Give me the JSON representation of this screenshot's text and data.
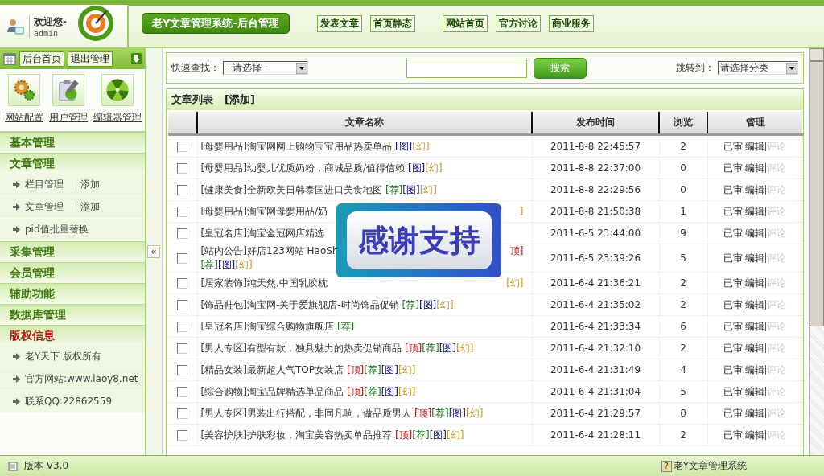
{
  "header": {
    "welcome": "欢迎您-",
    "user": "admin",
    "title": "老Y文章管理系统-后台管理",
    "nav_groups": [
      [
        "发表文章",
        "首页静态"
      ],
      [
        "网站首页",
        "官方讨论",
        "商业服务"
      ]
    ]
  },
  "sidebar": {
    "top_buttons": [
      "后台首页",
      "退出管理"
    ],
    "shortcuts": [
      {
        "label": "网站配置",
        "kind": "gears"
      },
      {
        "label": "用户管理",
        "kind": "clipboard"
      },
      {
        "label": "编辑器管理",
        "kind": "ball"
      }
    ],
    "sections": [
      {
        "title": "基本管理",
        "color": "#3d7a12"
      },
      {
        "title": "文章管理",
        "color": "#3d7a12",
        "items": [
          {
            "label": "栏目管理",
            "link": "添加"
          },
          {
            "label": "文章管理",
            "link": "添加"
          },
          {
            "label": "pid值批量替换"
          }
        ]
      },
      {
        "title": "采集管理",
        "color": "#3d7a12"
      },
      {
        "title": "会员管理",
        "color": "#3d7a12"
      },
      {
        "title": "辅助功能",
        "color": "#3d7a12"
      },
      {
        "title": "数据库管理",
        "color": "#3d7a12"
      },
      {
        "title": "版权信息",
        "color": "#b0200c",
        "items": [
          {
            "label": "老Y天下 版权所有"
          },
          {
            "label": "官方网站:www.laoy8.net"
          },
          {
            "label": "联系QQ:22862559"
          }
        ]
      }
    ],
    "collapse": "«"
  },
  "toolbar": {
    "search_label": "快速查找：",
    "search_select": "--请选择--",
    "search_button": "搜索",
    "jump_label": "跳转到：",
    "jump_select": "请选择分类"
  },
  "list": {
    "title": "文章列表",
    "add_link": "[添加]",
    "columns": [
      "文章名称",
      "发布时间",
      "浏览",
      "管理"
    ],
    "rows": [
      {
        "checked": false,
        "category": "[母婴用品]",
        "title": "淘宝网网上购物宝宝用品热卖单品",
        "tags": [
          {
            "text": "[图]",
            "color": "#10108a"
          },
          {
            "text": "[幻]",
            "color": "#c89a2a"
          }
        ],
        "time": "2011-8-8 22:45:57",
        "views": "2"
      },
      {
        "checked": false,
        "category": "[母婴用品]",
        "title": "幼婴儿优质奶粉，商城品质/值得信赖",
        "tags": [
          {
            "text": "[图]",
            "color": "#10108a"
          },
          {
            "text": "[幻]",
            "color": "#c89a2a"
          }
        ],
        "time": "2011-8-8 22:37:00",
        "views": "0"
      },
      {
        "checked": false,
        "category": "[健康美食]",
        "title": "全新欧美日韩泰国进口美食地图",
        "tags": [
          {
            "text": "[荐]",
            "color": "#1a7a1a"
          },
          {
            "text": "[图]",
            "color": "#10108a"
          },
          {
            "text": "[幻]",
            "color": "#c89a2a"
          }
        ],
        "time": "2011-8-8 22:29:56",
        "views": "0"
      },
      {
        "checked": false,
        "category": "[母婴用品]",
        "title": "淘宝网母婴用品/奶",
        "covered": true,
        "tags": [
          {
            "text": "]",
            "color": "#c89a2a"
          }
        ],
        "time": "2011-8-8 21:50:38",
        "views": "1"
      },
      {
        "checked": false,
        "category": "[皇冠名店]",
        "title": "淘宝金冠网店精选",
        "time": "2011-6-5 23:44:00",
        "views": "9"
      },
      {
        "checked": false,
        "category": "[站内公告]",
        "title": "好店123网站 HaoSh",
        "covered": true,
        "tags": [
          {
            "text": "顶]",
            "color": "#c01818"
          }
        ],
        "tags_line2": [
          {
            "text": "[荐]",
            "color": "#1a7a1a"
          },
          {
            "text": "[图]",
            "color": "#10108a"
          },
          {
            "text": "[幻]",
            "color": "#c89a2a"
          }
        ],
        "time": "2011-6-5 23:39:26",
        "views": "5"
      },
      {
        "checked": false,
        "category": "[居家装饰]",
        "title": "纯天然,中国乳胶枕",
        "covered": true,
        "tags": [
          {
            "text": "[幻]",
            "color": "#c89a2a"
          }
        ],
        "time": "2011-6-4 21:36:21",
        "views": "2"
      },
      {
        "checked": false,
        "category": "[饰品鞋包]",
        "title": "淘宝网-关于爱旗舰店-时尚饰品促销",
        "tags": [
          {
            "text": "[荐]",
            "color": "#1a7a1a"
          },
          {
            "text": "[图]",
            "color": "#10108a"
          },
          {
            "text": "[幻]",
            "color": "#c89a2a"
          }
        ],
        "time": "2011-6-4 21:35:02",
        "views": "2"
      },
      {
        "checked": false,
        "category": "[皇冠名店]",
        "title": "淘宝综合购物旗舰店",
        "tags": [
          {
            "text": "[荐]",
            "color": "#1a7a1a"
          }
        ],
        "time": "2011-6-4 21:33:34",
        "views": "6"
      },
      {
        "checked": false,
        "category": "[男人专区]",
        "title": "有型有款，独具魅力的热卖促销商品",
        "tags": [
          {
            "text": "[顶]",
            "color": "#c01818"
          },
          {
            "text": "[荐]",
            "color": "#1a7a1a"
          },
          {
            "text": "[图]",
            "color": "#10108a"
          },
          {
            "text": "[幻]",
            "color": "#c89a2a"
          }
        ],
        "time": "2011-6-4 21:32:10",
        "views": "2"
      },
      {
        "checked": false,
        "category": "[精品女装]",
        "title": "最新超人气TOP女装店",
        "tags": [
          {
            "text": "[顶]",
            "color": "#c01818"
          },
          {
            "text": "[荐]",
            "color": "#1a7a1a"
          },
          {
            "text": "[图]",
            "color": "#10108a"
          },
          {
            "text": "[幻]",
            "color": "#c89a2a"
          }
        ],
        "time": "2011-6-4 21:31:49",
        "views": "4"
      },
      {
        "checked": false,
        "category": "[综合购物]",
        "title": "淘宝品牌精选单品商品",
        "tags": [
          {
            "text": "[顶]",
            "color": "#c01818"
          },
          {
            "text": "[荐]",
            "color": "#1a7a1a"
          },
          {
            "text": "[图]",
            "color": "#10108a"
          },
          {
            "text": "[幻]",
            "color": "#c89a2a"
          }
        ],
        "time": "2011-6-4 21:31:04",
        "views": "5"
      },
      {
        "checked": false,
        "category": "[男人专区]",
        "title": "男装出行搭配，非同凡响，做品质男人",
        "tags": [
          {
            "text": "[顶]",
            "color": "#c01818"
          },
          {
            "text": "[荐]",
            "color": "#1a7a1a"
          },
          {
            "text": "[图]",
            "color": "#10108a"
          },
          {
            "text": "[幻]",
            "color": "#c89a2a"
          }
        ],
        "time": "2011-6-4 21:29:57",
        "views": "0"
      },
      {
        "checked": false,
        "category": "[美容护肤]",
        "title": "护肤彩妆，淘宝美容热卖单品推荐",
        "tags": [
          {
            "text": "[顶]",
            "color": "#c01818"
          },
          {
            "text": "[荐]",
            "color": "#1a7a1a"
          },
          {
            "text": "[图]",
            "color": "#10108a"
          },
          {
            "text": "[幻]",
            "color": "#c89a2a"
          }
        ],
        "time": "2011-6-4 21:28:11",
        "views": "2"
      }
    ],
    "actions": [
      [
        {
          "label": "已审",
          "disabled": false
        },
        {
          "label": "编辑",
          "disabled": false
        },
        {
          "label": "评论",
          "disabled": true
        }
      ],
      [
        {
          "label": "已审",
          "disabled": false
        },
        {
          "label": "编辑",
          "disabled": false
        },
        {
          "label": "评论",
          "disabled": true
        }
      ],
      [
        {
          "label": "已审",
          "disabled": false
        },
        {
          "label": "编辑",
          "disabled": false
        },
        {
          "label": "评论",
          "disabled": true
        }
      ],
      [
        {
          "label": "已审",
          "disabled": false
        },
        {
          "label": "编辑",
          "disabled": false
        },
        {
          "label": "评论",
          "disabled": true
        }
      ],
      [
        {
          "label": "已审",
          "disabled": false
        },
        {
          "label": "编辑",
          "disabled": false
        },
        {
          "label": "评论",
          "disabled": true
        }
      ],
      [
        {
          "label": "已审",
          "disabled": false
        },
        {
          "label": "编辑",
          "disabled": false
        },
        {
          "label": "评论",
          "disabled": true
        }
      ],
      [
        {
          "label": "已审",
          "disabled": false
        },
        {
          "label": "编辑",
          "disabled": false
        },
        {
          "label": "评论",
          "disabled": true
        }
      ],
      [
        {
          "label": "已审",
          "disabled": false
        },
        {
          "label": "编辑",
          "disabled": false
        },
        {
          "label": "评论",
          "disabled": true
        }
      ],
      [
        {
          "label": "已审",
          "disabled": false
        },
        {
          "label": "编辑",
          "disabled": false
        },
        {
          "label": "评论",
          "disabled": true
        }
      ],
      [
        {
          "label": "已审",
          "disabled": false
        },
        {
          "label": "编辑",
          "disabled": false
        },
        {
          "label": "评论",
          "disabled": true
        }
      ],
      [
        {
          "label": "已审",
          "disabled": false
        },
        {
          "label": "编辑",
          "disabled": false
        },
        {
          "label": "评论",
          "disabled": true
        }
      ],
      [
        {
          "label": "已审",
          "disabled": false
        },
        {
          "label": "编辑",
          "disabled": false
        },
        {
          "label": "评论",
          "disabled": true
        }
      ],
      [
        {
          "label": "已审",
          "disabled": false
        },
        {
          "label": "编辑",
          "disabled": false
        },
        {
          "label": "评论",
          "disabled": true
        }
      ],
      [
        {
          "label": "已审",
          "disabled": false
        },
        {
          "label": "编辑",
          "disabled": false
        },
        {
          "label": "评论",
          "disabled": true
        }
      ]
    ]
  },
  "overlay": {
    "text": "感谢支持"
  },
  "footer": {
    "version": "版本 V3.0",
    "help": "?",
    "product": "老Y文章管理系统"
  }
}
